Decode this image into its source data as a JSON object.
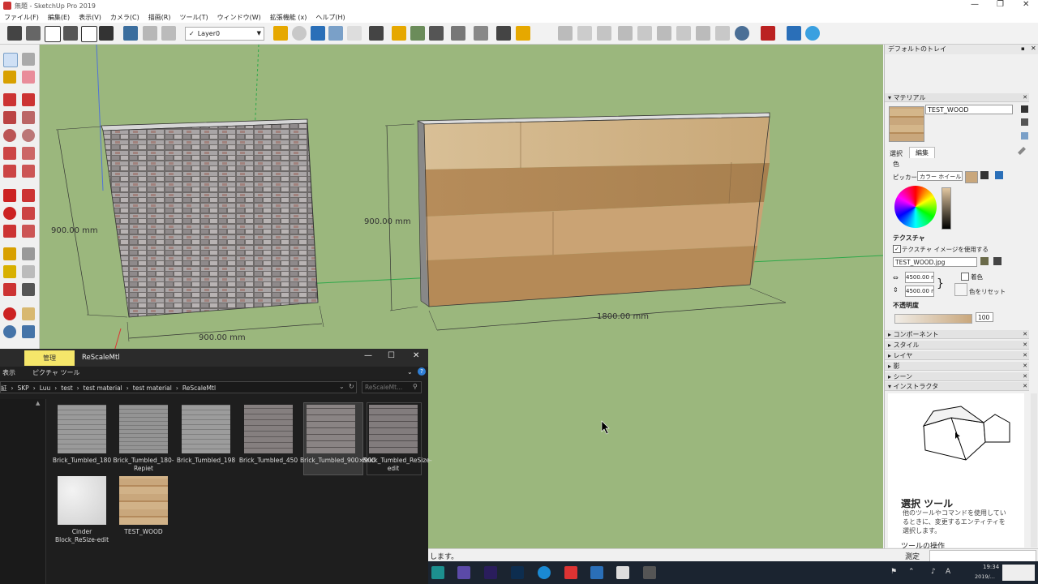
{
  "window": {
    "title": "無題 - SketchUp Pro 2019",
    "controls": [
      "—",
      "❐",
      "✕"
    ]
  },
  "menu": [
    "ファイル(F)",
    "編集(E)",
    "表示(V)",
    "カメラ(C)",
    "描画(R)",
    "ツール(T)",
    "ウィンドウ(W)",
    "拡張機能 (x)",
    "ヘルプ(H)"
  ],
  "toolbar": {
    "layer": "Layer0",
    "layer_check": "✓"
  },
  "viewport": {
    "dims": {
      "brick_height": "900.00 mm",
      "brick_width": "900.00 mm",
      "wood_height": "900.00 mm",
      "wood_width": "1800.00 mm"
    }
  },
  "tray": {
    "title": "デフォルトのトレイ",
    "materials": {
      "header": "マテリアル",
      "name": "TEST_WOOD",
      "tabs": [
        "選択",
        "編集"
      ],
      "color_label": "色",
      "picker_label": "ピッカー:",
      "picker_value": "カラー ホイール",
      "texture_label": "テクスチャ",
      "use_texture": "テクスチャ イメージを使用する",
      "texture_file": "TEST_WOOD.jpg",
      "width": "4500.00 mm",
      "height": "4500.00 mm",
      "colorize": "着色",
      "reset_color": "色をリセット",
      "opacity_label": "不透明度",
      "opacity": "100"
    },
    "panels": [
      "コンポーネント",
      "スタイル",
      "レイヤ",
      "影",
      "シーン",
      "インストラクタ"
    ],
    "instructor": {
      "title": "選択 ツール",
      "body": "他のツールやコマンドを使用しているときに、変更するエンティティを選択します。",
      "section": "ツールの操作"
    }
  },
  "explorer": {
    "ribbon_manage": "管理",
    "ribbon_title": "ReScaleMtl",
    "ribbon_view": "表示",
    "ribbon_picture_tools": "ピクチャ ツール",
    "controls": [
      "—",
      "☐",
      "✕"
    ],
    "breadcrumb": [
      "証",
      "SKP",
      "Luu",
      "test",
      "test material",
      "test material",
      "ReScaleMtl"
    ],
    "search_placeholder": "ReScaleMt...",
    "files": [
      {
        "name": "Brick_Tumbled_180",
        "color": "#8f8f8f"
      },
      {
        "name": "Brick_Tumbled_180-Repiet",
        "color": "#8a8a8a"
      },
      {
        "name": "Brick_Tumbled_198",
        "color": "#909090"
      },
      {
        "name": "Brick_Tumbled_450",
        "color": "#7b7574"
      },
      {
        "name": "Brick_Tumbled_900×900",
        "color": "#6f6a6a"
      },
      {
        "name": "Brick_Tumbled_ReSize-edit",
        "color": "#6c6869"
      },
      {
        "name": "Cinder Block_ReSize-edit",
        "color": "#d9d9d9"
      },
      {
        "name": "TEST_WOOD",
        "color": "#c9a77c"
      }
    ]
  },
  "status": {
    "text": "します。",
    "measure_label": "測定"
  },
  "taskbar": {
    "time": "19:34",
    "date": "2019/...",
    "ime": "A"
  }
}
